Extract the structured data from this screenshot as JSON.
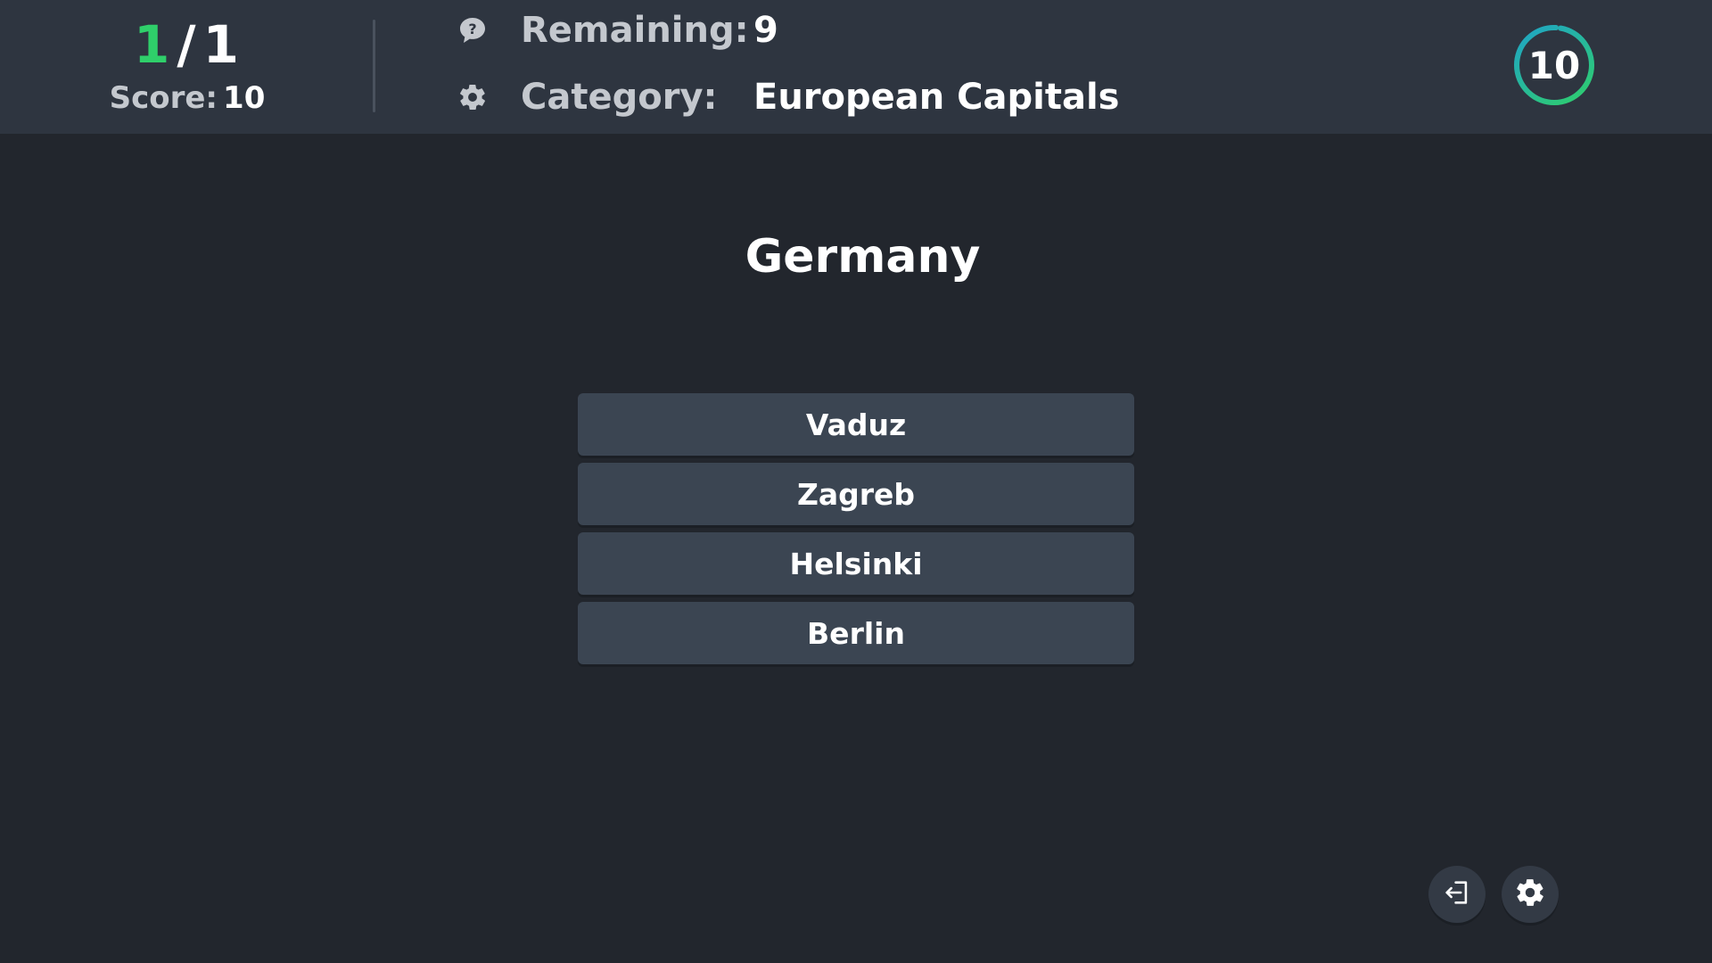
{
  "header": {
    "progress": {
      "correct": "1",
      "separator": "/",
      "total": "1"
    },
    "score": {
      "label": "Score:",
      "value": "10"
    },
    "remaining": {
      "icon": "question-bubble-icon",
      "label": "Remaining:",
      "value": "9"
    },
    "category": {
      "icon": "gear-icon",
      "label": "Category:",
      "value": "European Capitals"
    },
    "timer": {
      "value": "10",
      "ring_colors": [
        "#2fcf6a",
        "#1fa3c8"
      ]
    }
  },
  "question": {
    "text": "Germany"
  },
  "answers": [
    {
      "label": "Vaduz"
    },
    {
      "label": "Zagreb"
    },
    {
      "label": "Helsinki"
    },
    {
      "label": "Berlin"
    }
  ],
  "controls": {
    "exit_icon": "exit-icon",
    "settings_icon": "gear-icon"
  },
  "colors": {
    "background": "#22262d",
    "topbar": "#2e3540",
    "answer_button": "#3b4552",
    "correct_accent": "#2fcf6a"
  }
}
